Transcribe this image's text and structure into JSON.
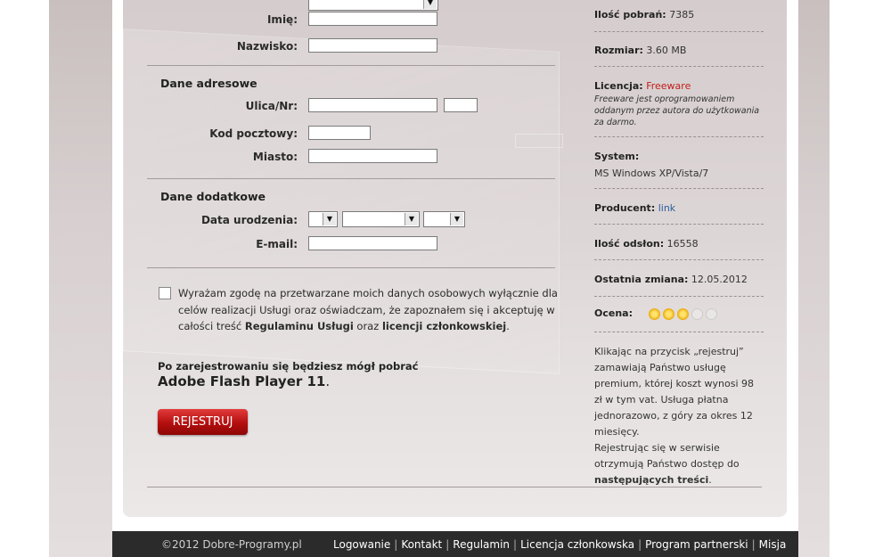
{
  "form": {
    "imie_label": "Imię:",
    "nazwisko_label": "Nazwisko:",
    "section_address": "Dane adresowe",
    "ulica_label": "Ulica/Nr:",
    "kod_label": "Kod pocztowy:",
    "miasto_label": "Miasto:",
    "section_extra": "Dane dodatkowe",
    "dob_label": "Data urodzenia:",
    "email_label": "E-mail:",
    "consent_pre": "Wyrażam zgodę na przetwarzane moich danych osobowych wyłącznie dla celów realizacji Usługi oraz oświadczam, że zapoznałem się i akceptuję w całości treść",
    "consent_regulamin": "Regulaminu Usługi",
    "consent_mid": "oraz",
    "consent_licencja": "licencji członkowskiej",
    "consent_end": ".",
    "after_register": "Po zarejestrowaniu się będziesz mógł pobrać",
    "product_name": "Adobe Flash Player 11",
    "product_dot": ".",
    "register_button": "REJESTRUJ"
  },
  "info": {
    "downloads_label": "Ilość pobrań:",
    "downloads_value": "7385",
    "size_label": "Rozmiar:",
    "size_value": "3.60 MB",
    "license_label": "Licencja:",
    "license_value": "Freeware",
    "license_note": "Freeware jest oprogramowaniem oddanym przez autora do użytkowania za darmo.",
    "system_label": "System:",
    "system_value": "MS Windows XP/Vista/7",
    "producer_label": "Producent:",
    "producer_link": "link",
    "views_label": "Ilość odsłon:",
    "views_value": "16558",
    "last_change_label": "Ostatnia zmiana:",
    "last_change_value": "12.05.2012",
    "rating_label": "Ocena:",
    "rating_value": 3,
    "rating_max": 5,
    "desc_pre": "Klikając na przycisk „rejestruj” zamawiają Państwo usługę premium, której koszt wynosi 98 zł w tym vat. Usługa płatna jednorazowo, z góry za okres 12 miesięcy.",
    "desc_mid": "Rejestrując się w serwisie otrzymują Państwo dostęp do",
    "desc_bold": "następujących treści",
    "desc_end": "."
  },
  "footer": {
    "copyright": "©2012 Dobre-Programy.pl",
    "links": [
      "Logowanie",
      "Kontakt",
      "Regulamin",
      "Licencja członkowska",
      "Program partnerski",
      "Misja"
    ]
  },
  "colors": {
    "accent_red": "#c0201a",
    "link_blue": "#2a5fa0",
    "footer_bg": "#2b2b2b"
  }
}
